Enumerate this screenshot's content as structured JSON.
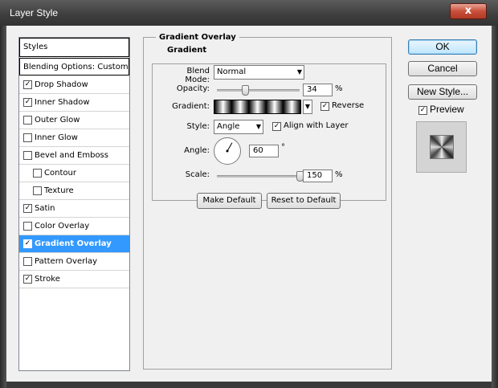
{
  "window": {
    "title": "Layer Style",
    "close": "x"
  },
  "styles_list": {
    "header": "Styles",
    "blending": "Blending Options: Custom",
    "items": [
      {
        "label": "Drop Shadow",
        "checked": true
      },
      {
        "label": "Inner Shadow",
        "checked": true
      },
      {
        "label": "Outer Glow",
        "checked": false
      },
      {
        "label": "Inner Glow",
        "checked": false
      },
      {
        "label": "Bevel and Emboss",
        "checked": false
      },
      {
        "label": "Contour",
        "checked": false
      },
      {
        "label": "Texture",
        "checked": false
      },
      {
        "label": "Satin",
        "checked": true
      },
      {
        "label": "Color Overlay",
        "checked": false
      },
      {
        "label": "Gradient Overlay",
        "checked": true,
        "selected": true
      },
      {
        "label": "Pattern Overlay",
        "checked": false
      },
      {
        "label": "Stroke",
        "checked": true
      }
    ]
  },
  "gradient_overlay": {
    "section_title": "Gradient Overlay",
    "group_title": "Gradient",
    "blend_mode_label": "Blend Mode:",
    "blend_mode_value": "Normal",
    "opacity_label": "Opacity:",
    "opacity_value": "34",
    "opacity_fraction": 0.34,
    "opacity_unit": "%",
    "gradient_label": "Gradient:",
    "reverse_label": "Reverse",
    "reverse_checked": true,
    "style_label": "Style:",
    "style_value": "Angle",
    "align_label": "Align with Layer",
    "align_checked": true,
    "angle_label": "Angle:",
    "angle_value": "60",
    "angle_unit": "°",
    "scale_label": "Scale:",
    "scale_value": "150",
    "scale_fraction": 1.0,
    "scale_unit": "%",
    "make_default": "Make Default",
    "reset_default": "Reset to Default"
  },
  "buttons": {
    "ok": "OK",
    "cancel": "Cancel",
    "new_style": "New Style...",
    "preview": "Preview",
    "preview_checked": true
  },
  "colors": {
    "selection": "#3399ff",
    "titlebar": "#3d3d3d",
    "close": "#c8503b"
  }
}
